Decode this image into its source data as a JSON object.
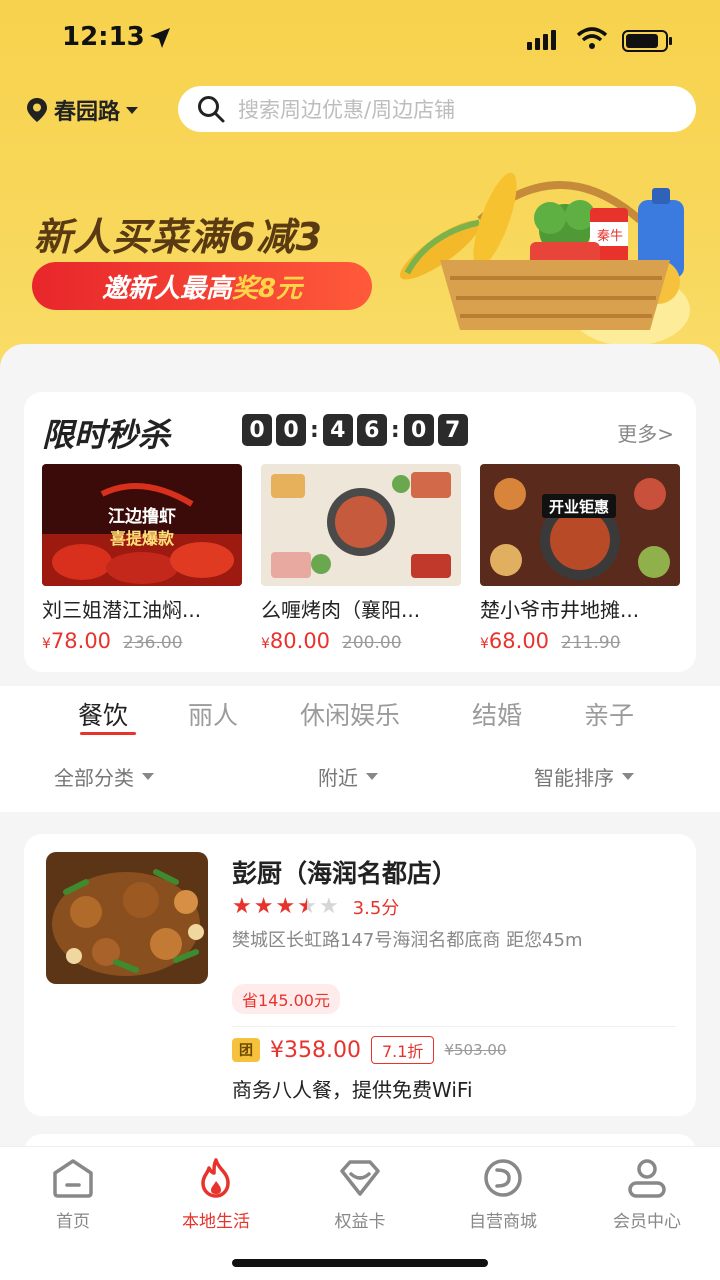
{
  "status": {
    "time": "12:13"
  },
  "location": {
    "label": "春园路"
  },
  "search": {
    "placeholder": "搜索周边优惠/周边店铺"
  },
  "banner": {
    "title": "新人买菜满6减3",
    "button_prefix": "邀新人最高",
    "button_highlight": "奖8元",
    "basket_label": "秦牛"
  },
  "flash_sale": {
    "title": "限时秒杀",
    "countdown": [
      "0",
      "0",
      "4",
      "6",
      "0",
      "7"
    ],
    "more": "更多>",
    "items": [
      {
        "name": "刘三姐潜江油焖...",
        "price": "78.00",
        "currency": "¥",
        "original": "236.00",
        "image_text": [
          "江边撸虾",
          "喜提爆款"
        ]
      },
      {
        "name": "么喱烤肉（襄阳...",
        "price": "80.00",
        "currency": "¥",
        "original": "200.00"
      },
      {
        "name": "楚小爷市井地摊...",
        "price": "68.00",
        "currency": "¥",
        "original": "211.90",
        "image_text": [
          "开业钜惠"
        ]
      }
    ]
  },
  "tabs": [
    "餐饮",
    "丽人",
    "休闲娱乐",
    "结婚",
    "亲子"
  ],
  "filters": [
    "全部分类",
    "附近",
    "智能排序"
  ],
  "store": {
    "name": "彭厨（海润名都店）",
    "rating_value": 3.5,
    "rating": "3.5分",
    "address": "樊城区长虹路147号海润名都底商  距您45m",
    "savings": "省145.00元",
    "tuan": "团",
    "deal_price": "¥358.00",
    "discount": "7.1折",
    "deal_original": "¥503.00",
    "description": "商务八人餐，提供免费WiFi"
  },
  "bottom_nav": [
    {
      "label": "首页",
      "icon": "home-icon",
      "active": false
    },
    {
      "label": "本地生活",
      "icon": "flame-icon",
      "active": true
    },
    {
      "label": "权益卡",
      "icon": "heart-card-icon",
      "active": false
    },
    {
      "label": "自营商城",
      "icon": "mall-icon",
      "active": false
    },
    {
      "label": "会员中心",
      "icon": "user-icon",
      "active": false
    }
  ],
  "colors": {
    "accent": "#e8332d",
    "header": "#f7d24e"
  }
}
